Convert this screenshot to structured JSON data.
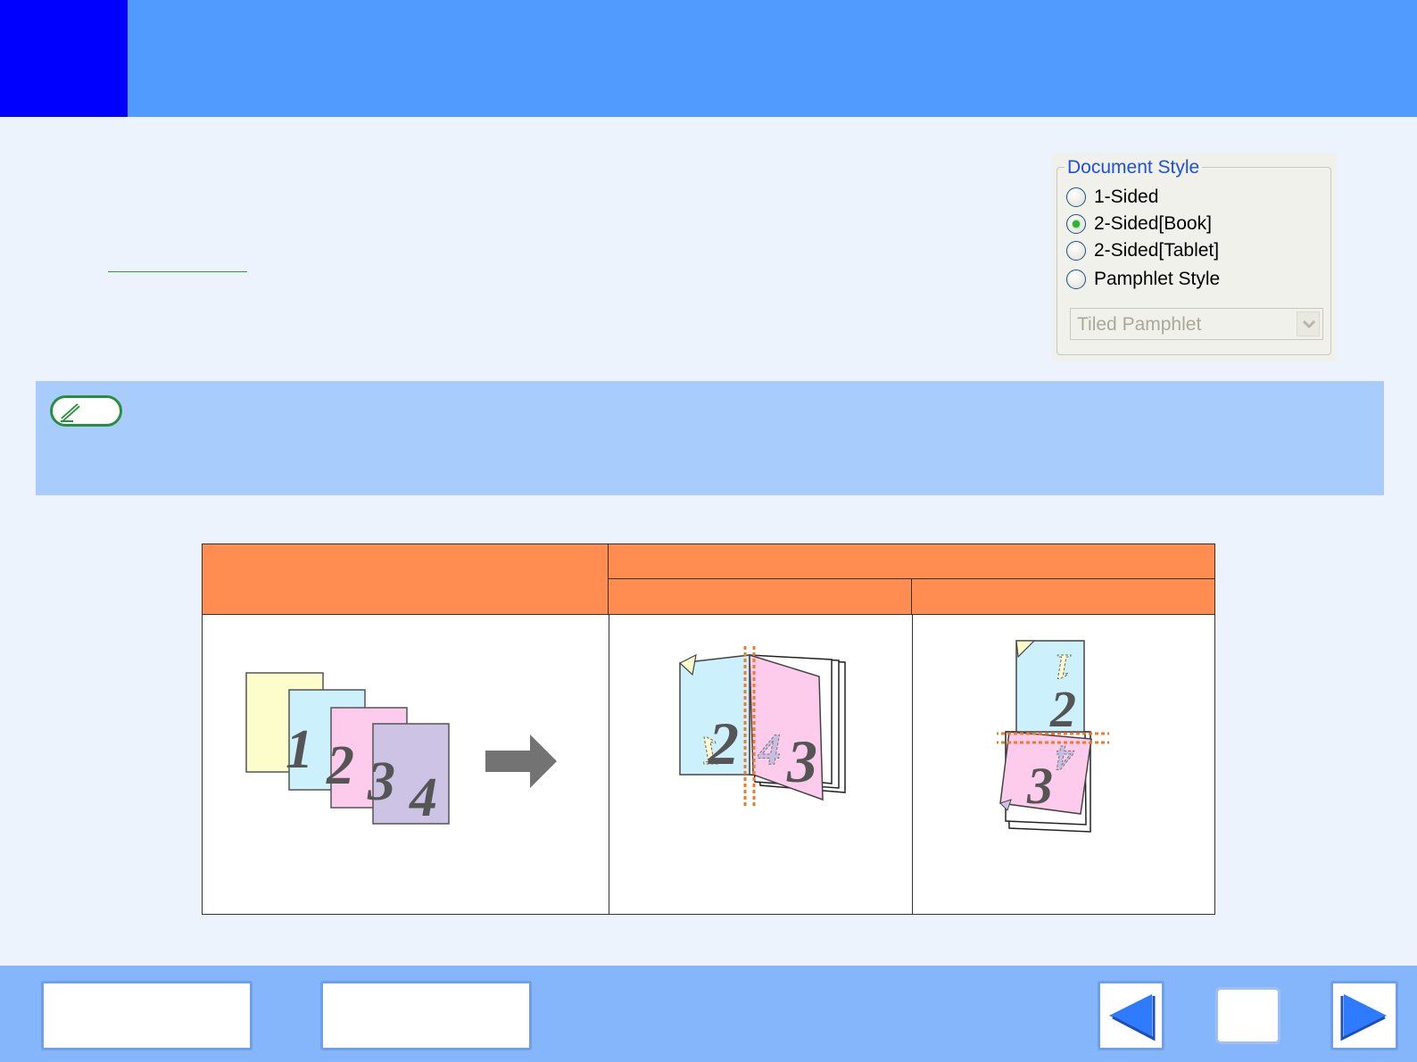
{
  "header": {
    "accent_color": "#0000ff",
    "bar_color": "#519bff"
  },
  "document_style": {
    "title": "Document Style",
    "options": [
      {
        "label": "1-Sided",
        "checked": false
      },
      {
        "label": "2-Sided[Book]",
        "checked": true
      },
      {
        "label": "2-Sided[Tablet]",
        "checked": false
      },
      {
        "label": "Pamphlet Style",
        "checked": false
      }
    ],
    "pamphlet_select": {
      "value": "Tiled Pamphlet",
      "disabled": true
    }
  },
  "note": {
    "icon": "pencil-icon",
    "pill_color": "#2a8f3c"
  },
  "illustration_table": {
    "header_color": "#ff8c50",
    "original_pages": [
      "1",
      "2",
      "3",
      "4"
    ],
    "book_pages": [
      "1",
      "2",
      "4",
      "3"
    ],
    "tablet_pages": [
      "1",
      "2",
      "4",
      "3"
    ]
  },
  "footer": {
    "buttons": [
      {
        "name": "contents-button"
      },
      {
        "name": "index-button"
      },
      {
        "name": "prev-page-button",
        "icon": "left-arrow-icon"
      },
      {
        "name": "home-button"
      },
      {
        "name": "next-page-button",
        "icon": "right-arrow-icon"
      }
    ]
  }
}
